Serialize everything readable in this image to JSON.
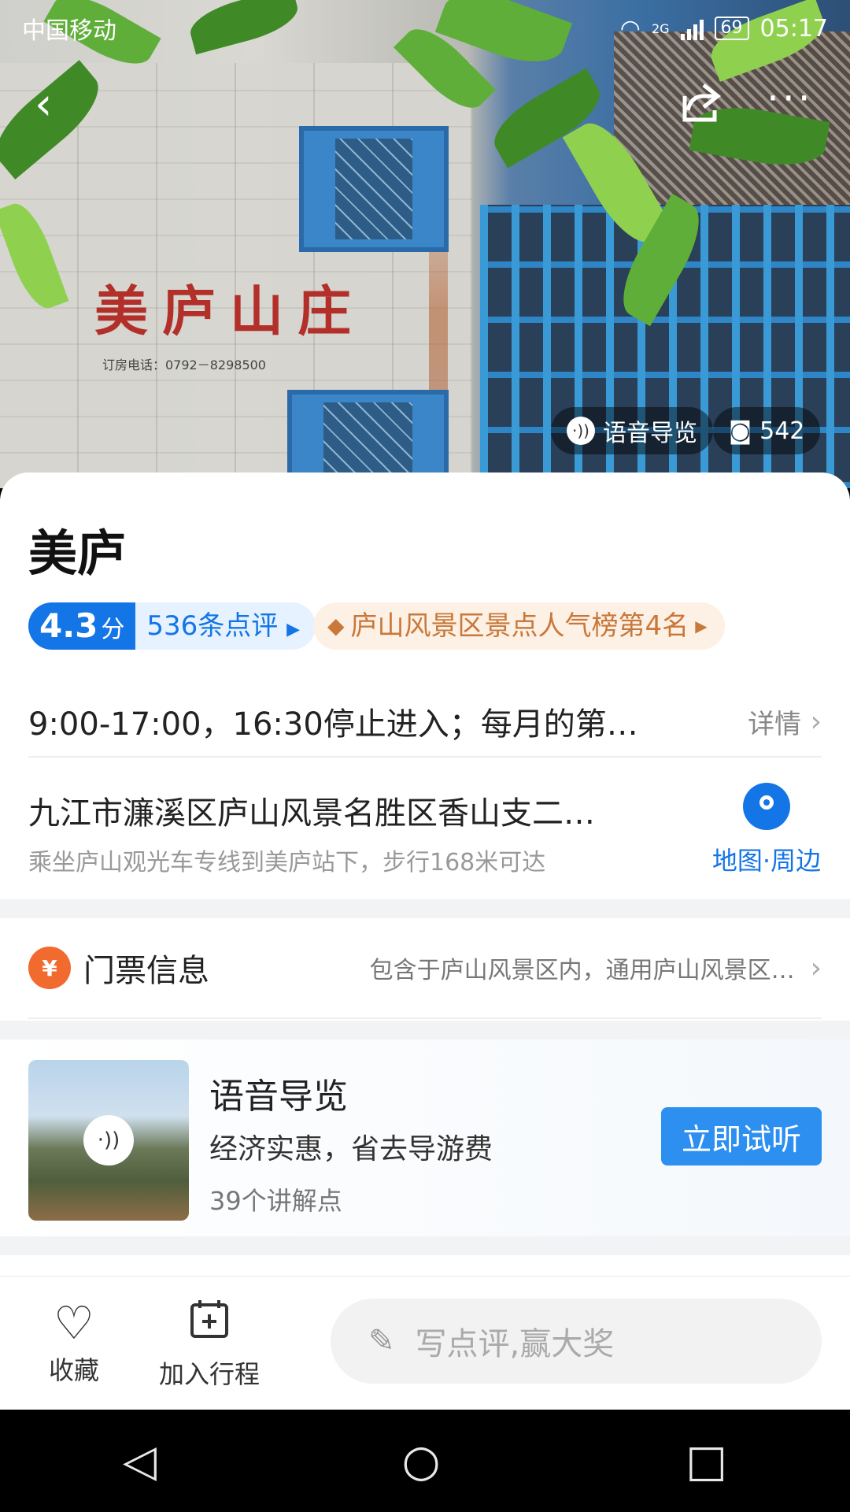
{
  "status_bar": {
    "carrier": "中国移动",
    "network": "2G",
    "battery": "69",
    "time": "05:17"
  },
  "hero": {
    "sign_text": "美庐山庄",
    "sign_phone": "订房电话：0792－8298500",
    "audio_chip_label": "语音导览",
    "photo_count": "542"
  },
  "poi": {
    "name": "美庐",
    "score": "4.3",
    "score_unit": "分",
    "reviews_label": "536条点评",
    "rank_label": "庐山风景区景点人气榜第4名",
    "hours": "9:00-17:00，16:30停止进入；每月的第…",
    "hours_more": "详情",
    "address": "九江市濂溪区庐山风景名胜区香山支二…",
    "transit": "乘坐庐山观光车专线到美庐站下，步行168米可达",
    "map_label": "地图·周边"
  },
  "ticket": {
    "icon_text": "¥",
    "label": "门票信息",
    "desc": "包含于庐山风景区内，通用庐山风景区…"
  },
  "audio_guide": {
    "title": "语音导览",
    "subtitle": "经济实惠，省去导游费",
    "count": "39个讲解点",
    "button": "立即试听"
  },
  "bottom_bar": {
    "favorite": "收藏",
    "add_itinerary": "加入行程",
    "review_placeholder": "写点评,赢大奖"
  },
  "colors": {
    "accent": "#1475e6",
    "rank": "#c8783a",
    "ticket": "#f26b2e"
  }
}
